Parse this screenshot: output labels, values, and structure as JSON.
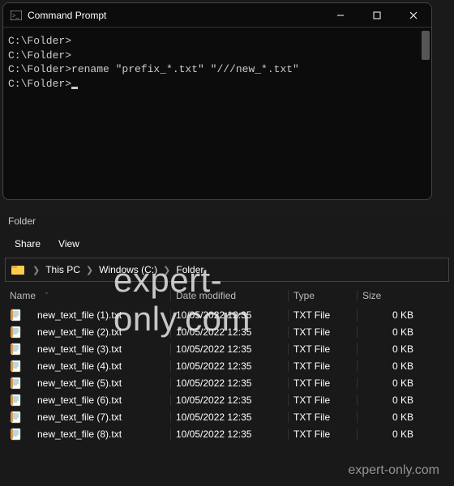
{
  "cmd": {
    "title": "Command Prompt",
    "lines": [
      "C:\\Folder>",
      "C:\\Folder>",
      "C:\\Folder>rename \"prefix_*.txt\" \"///new_*.txt\"",
      "",
      "C:\\Folder>"
    ]
  },
  "explorer": {
    "header": "Folder",
    "menu": {
      "share": "Share",
      "view": "View"
    },
    "breadcrumb": [
      "This PC",
      "Windows  (C:)",
      "Folder"
    ],
    "columns": {
      "name": "Name",
      "date": "Date modified",
      "type": "Type",
      "size": "Size"
    },
    "rows": [
      {
        "name": "new_text_file (1).txt",
        "date": "10/05/2022 12:35",
        "type": "TXT File",
        "size": "0 KB"
      },
      {
        "name": "new_text_file (2).txt",
        "date": "10/05/2022 12:35",
        "type": "TXT File",
        "size": "0 KB"
      },
      {
        "name": "new_text_file (3).txt",
        "date": "10/05/2022 12:35",
        "type": "TXT File",
        "size": "0 KB"
      },
      {
        "name": "new_text_file (4).txt",
        "date": "10/05/2022 12:35",
        "type": "TXT File",
        "size": "0 KB"
      },
      {
        "name": "new_text_file (5).txt",
        "date": "10/05/2022 12:35",
        "type": "TXT File",
        "size": "0 KB"
      },
      {
        "name": "new_text_file (6).txt",
        "date": "10/05/2022 12:35",
        "type": "TXT File",
        "size": "0 KB"
      },
      {
        "name": "new_text_file (7).txt",
        "date": "10/05/2022 12:35",
        "type": "TXT File",
        "size": "0 KB"
      },
      {
        "name": "new_text_file (8).txt",
        "date": "10/05/2022 12:35",
        "type": "TXT File",
        "size": "0 KB"
      }
    ]
  },
  "watermark": "expert-only.com",
  "watermark_small": "expert-only.com"
}
